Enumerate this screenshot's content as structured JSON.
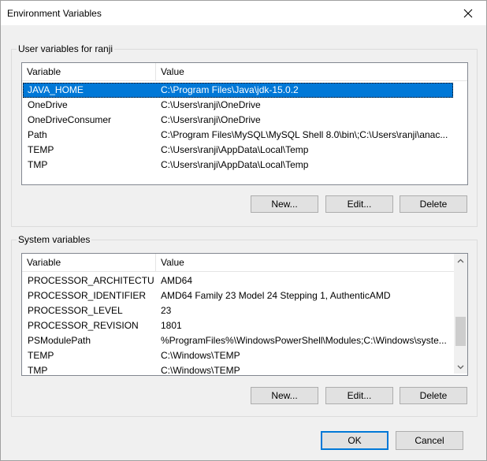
{
  "window": {
    "title": "Environment Variables"
  },
  "user_vars": {
    "label": "User variables for ranji",
    "columns": [
      "Variable",
      "Value"
    ],
    "rows": [
      {
        "variable": "JAVA_HOME",
        "value": "C:\\Program Files\\Java\\jdk-15.0.2",
        "selected": true
      },
      {
        "variable": "OneDrive",
        "value": "C:\\Users\\ranji\\OneDrive"
      },
      {
        "variable": "OneDriveConsumer",
        "value": "C:\\Users\\ranji\\OneDrive"
      },
      {
        "variable": "Path",
        "value": "C:\\Program Files\\MySQL\\MySQL Shell 8.0\\bin\\;C:\\Users\\ranji\\anac..."
      },
      {
        "variable": "TEMP",
        "value": "C:\\Users\\ranji\\AppData\\Local\\Temp"
      },
      {
        "variable": "TMP",
        "value": "C:\\Users\\ranji\\AppData\\Local\\Temp"
      }
    ],
    "buttons": {
      "new": "New...",
      "edit": "Edit...",
      "delete": "Delete"
    }
  },
  "system_vars": {
    "label": "System variables",
    "columns": [
      "Variable",
      "Value"
    ],
    "rows": [
      {
        "variable": "PROCESSOR_ARCHITECTURE",
        "value": "AMD64"
      },
      {
        "variable": "PROCESSOR_IDENTIFIER",
        "value": "AMD64 Family 23 Model 24 Stepping 1, AuthenticAMD"
      },
      {
        "variable": "PROCESSOR_LEVEL",
        "value": "23"
      },
      {
        "variable": "PROCESSOR_REVISION",
        "value": "1801"
      },
      {
        "variable": "PSModulePath",
        "value": "%ProgramFiles%\\WindowsPowerShell\\Modules;C:\\Windows\\syste..."
      },
      {
        "variable": "TEMP",
        "value": "C:\\Windows\\TEMP"
      },
      {
        "variable": "TMP",
        "value": "C:\\Windows\\TEMP"
      }
    ],
    "buttons": {
      "new": "New...",
      "edit": "Edit...",
      "delete": "Delete"
    }
  },
  "footer": {
    "ok": "OK",
    "cancel": "Cancel"
  },
  "icons": {
    "close": "close-icon",
    "scroll_up": "chevron-up-icon",
    "scroll_down": "chevron-down-icon"
  },
  "colors": {
    "selection": "#0078d7",
    "default_button_border": "#0078d7"
  }
}
